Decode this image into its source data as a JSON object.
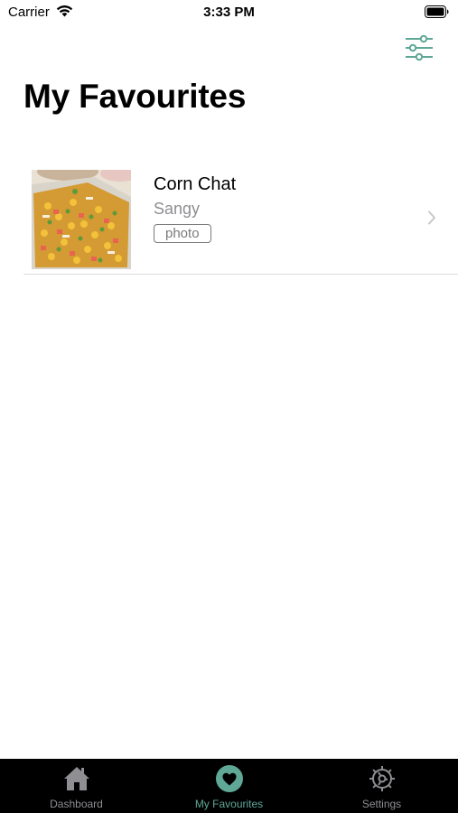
{
  "status_bar": {
    "carrier": "Carrier",
    "time": "3:33 PM"
  },
  "header": {
    "title": "My Favourites",
    "filter_icon": "sliders-icon"
  },
  "favourites": [
    {
      "title": "Corn Chat",
      "subtitle": "Sangy",
      "tag": "photo"
    }
  ],
  "tab_bar": {
    "tabs": [
      {
        "label": "Dashboard",
        "icon": "house-icon",
        "active": false
      },
      {
        "label": "My Favourites",
        "icon": "heart-icon",
        "active": true
      },
      {
        "label": "Settings",
        "icon": "gear-icon",
        "active": false
      }
    ]
  },
  "colors": {
    "accent": "#5fa896",
    "tab_bar_bg": "#000000",
    "inactive": "#8e8e93"
  }
}
